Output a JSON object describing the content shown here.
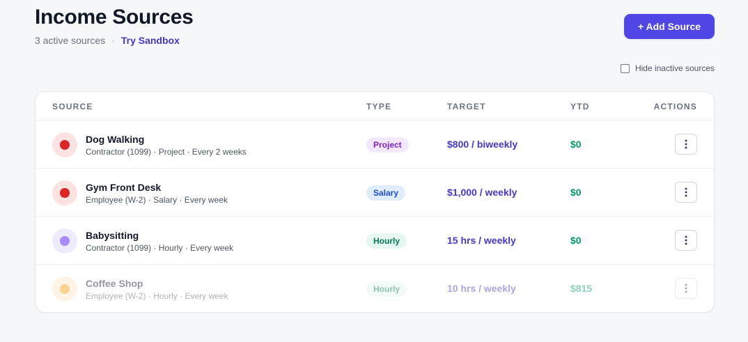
{
  "header": {
    "title": "Income Sources",
    "active_count": "3 active sources",
    "separator": "·",
    "sandbox_link": "Try Sandbox",
    "add_button": "+ Add Source",
    "hide_inactive_label": "Hide inactive sources",
    "hide_inactive_checked": false
  },
  "table": {
    "columns": [
      "SOURCE",
      "TYPE",
      "TARGET",
      "YTD",
      "ACTIONS"
    ],
    "rows": [
      {
        "name": "Dog Walking",
        "meta": "Contractor (1099) · Project · Every 2 weeks",
        "type": "Project",
        "target": "$800 / biweekly",
        "ytd": "$0",
        "dot_color": "#dc2626",
        "avatar_bg": "#fde2e2",
        "badge_bg": "#f3e8ff",
        "badge_color": "#7e22ce",
        "inactive": false,
        "actions_icon": "more-vertical-icon"
      },
      {
        "name": "Gym Front Desk",
        "meta": "Employee (W-2) · Salary · Every week",
        "type": "Salary",
        "target": "$1,000 / weekly",
        "ytd": "$0",
        "dot_color": "#dc2626",
        "avatar_bg": "#fde2e2",
        "badge_bg": "#e0edff",
        "badge_color": "#1d4ed8",
        "inactive": false,
        "actions_icon": "more-vertical-icon"
      },
      {
        "name": "Babysitting",
        "meta": "Contractor (1099) · Hourly · Every week",
        "type": "Hourly",
        "target": "15 hrs / weekly",
        "ytd": "$0",
        "dot_color": "#a78bfa",
        "avatar_bg": "#eeeaff",
        "badge_bg": "#e6f7f1",
        "badge_color": "#047857",
        "inactive": false,
        "actions_icon": "more-vertical-icon"
      },
      {
        "name": "Coffee Shop",
        "meta": "Employee (W-2) · Hourly · Every week",
        "type": "Hourly",
        "target": "10 hrs / weekly",
        "ytd": "$815",
        "dot_color": "#f59e0b",
        "avatar_bg": "#fde7c7",
        "badge_bg": "#e6f7f1",
        "badge_color": "#047857",
        "inactive": true,
        "actions_icon": "more-vertical-icon"
      }
    ]
  },
  "colors": {
    "accent": "#4f46e5",
    "link": "#4338ca",
    "ytd_green": "#059669"
  }
}
